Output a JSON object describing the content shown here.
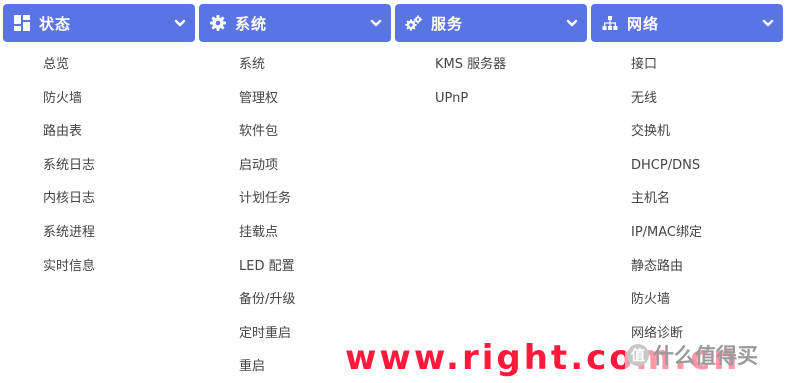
{
  "menus": [
    {
      "title": "状态",
      "icon": "dashboard-icon",
      "items": [
        "总览",
        "防火墙",
        "路由表",
        "系统日志",
        "内核日志",
        "系统进程",
        "实时信息"
      ]
    },
    {
      "title": "系统",
      "icon": "gear-icon",
      "items": [
        "系统",
        "管理权",
        "软件包",
        "启动项",
        "计划任务",
        "挂载点",
        "LED 配置",
        "备份/升级",
        "定时重启",
        "重启"
      ]
    },
    {
      "title": "服务",
      "icon": "gears-icon",
      "items": [
        "KMS 服务器",
        "UPnP"
      ]
    },
    {
      "title": "网络",
      "icon": "sitemap-icon",
      "items": [
        "接口",
        "无线",
        "交换机",
        "DHCP/DNS",
        "主机名",
        "IP/MAC绑定",
        "静态路由",
        "防火墙",
        "网络诊断"
      ]
    }
  ],
  "watermark": {
    "url_text": "www.right.com.cn",
    "badge": "值",
    "brand_text": "什么值得买"
  },
  "colors": {
    "header_bg": "#5b74e4",
    "header_text": "#ffffff",
    "item_text": "#444444",
    "watermark_red": "#ff1a3c"
  }
}
